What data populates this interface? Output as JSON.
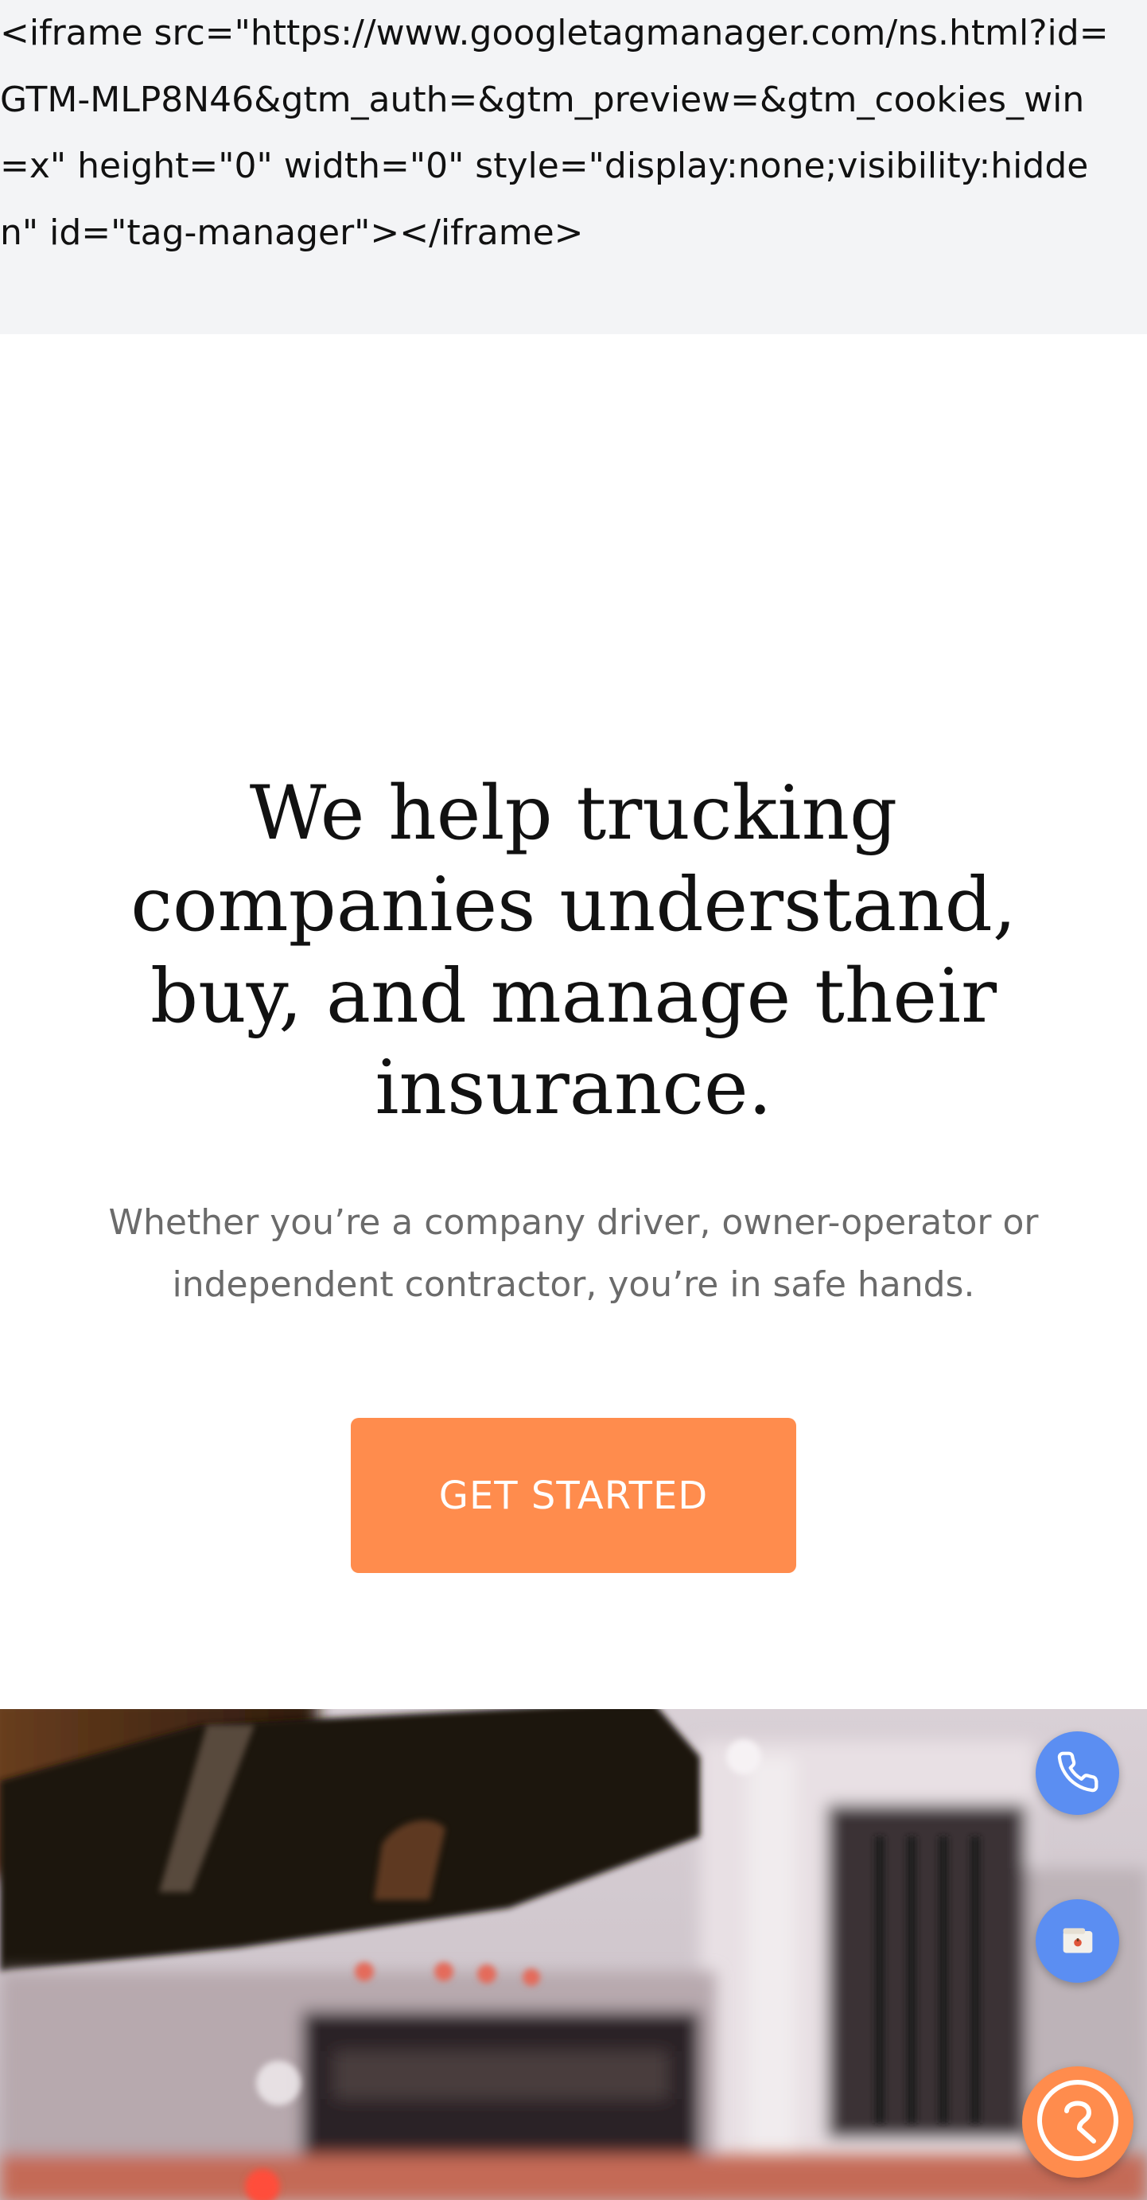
{
  "noscript": {
    "text": "<iframe src=\"https://www.googletagmanager.com/ns.html?id=GTM-MLP8N46&gtm_auth=&gtm_preview=&gtm_cookies_win=x\" height=\"0\" width=\"0\" style=\"display:none;visibility:hidden\" id=\"tag-manager\"></iframe>"
  },
  "hero": {
    "title": "We help trucking companies understand, buy, and manage their insurance.",
    "subtitle": "Whether you’re a company driver, owner-operator or independent contractor, you’re in safe hands.",
    "cta_label": "GET STARTED"
  },
  "floating_actions": {
    "phone_icon": "phone-icon",
    "wallet_icon": "wallet-icon",
    "support_icon": "support-chat-icon"
  },
  "colors": {
    "accent_orange": "#ff8c4d",
    "action_blue": "#5b8ef2",
    "noscript_bg": "#f3f4f6",
    "subtitle_gray": "#6b6b6b"
  }
}
